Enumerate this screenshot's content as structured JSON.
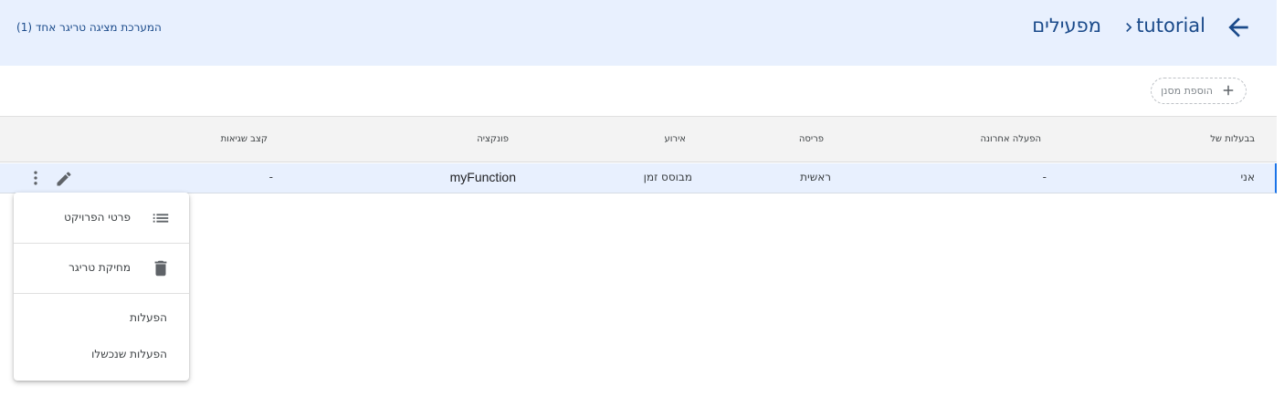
{
  "colors": {
    "header_bg": "#e8f0fe",
    "title": "#1a4a8a",
    "row_highlight": "#e8f0fe",
    "accent": "#1a73e8"
  },
  "header": {
    "back_icon": "arrow-back-icon",
    "project": "tutorial",
    "chevron_icon": "chevron-right-icon",
    "current": "מפעילים",
    "status": "המערכת מציגה טריגר אחד (1)"
  },
  "filter": {
    "label": "הוספת מסנן",
    "icon": "plus-icon"
  },
  "table": {
    "columns": [
      "בבעלות של",
      "הפעלה אחרונה",
      "פריסה",
      "אירוע",
      "פונקציה",
      "קצב שגיאות"
    ],
    "rows": [
      {
        "owner": "אני",
        "last_run": "-",
        "deployment": "ראשית",
        "event": "מבוסס זמן",
        "function": "myFunction",
        "error_rate": "-"
      }
    ],
    "row_actions": {
      "edit_icon": "pencil-icon",
      "more_icon": "more-vert-icon"
    }
  },
  "menu": {
    "items": [
      {
        "label": "פרטי הפרויקט",
        "icon": "list-icon"
      },
      {
        "label": "מחיקת טריגר",
        "icon": "trash-icon"
      },
      {
        "label": "הפעלות"
      },
      {
        "label": "הפעלות שנכשלו"
      }
    ]
  }
}
